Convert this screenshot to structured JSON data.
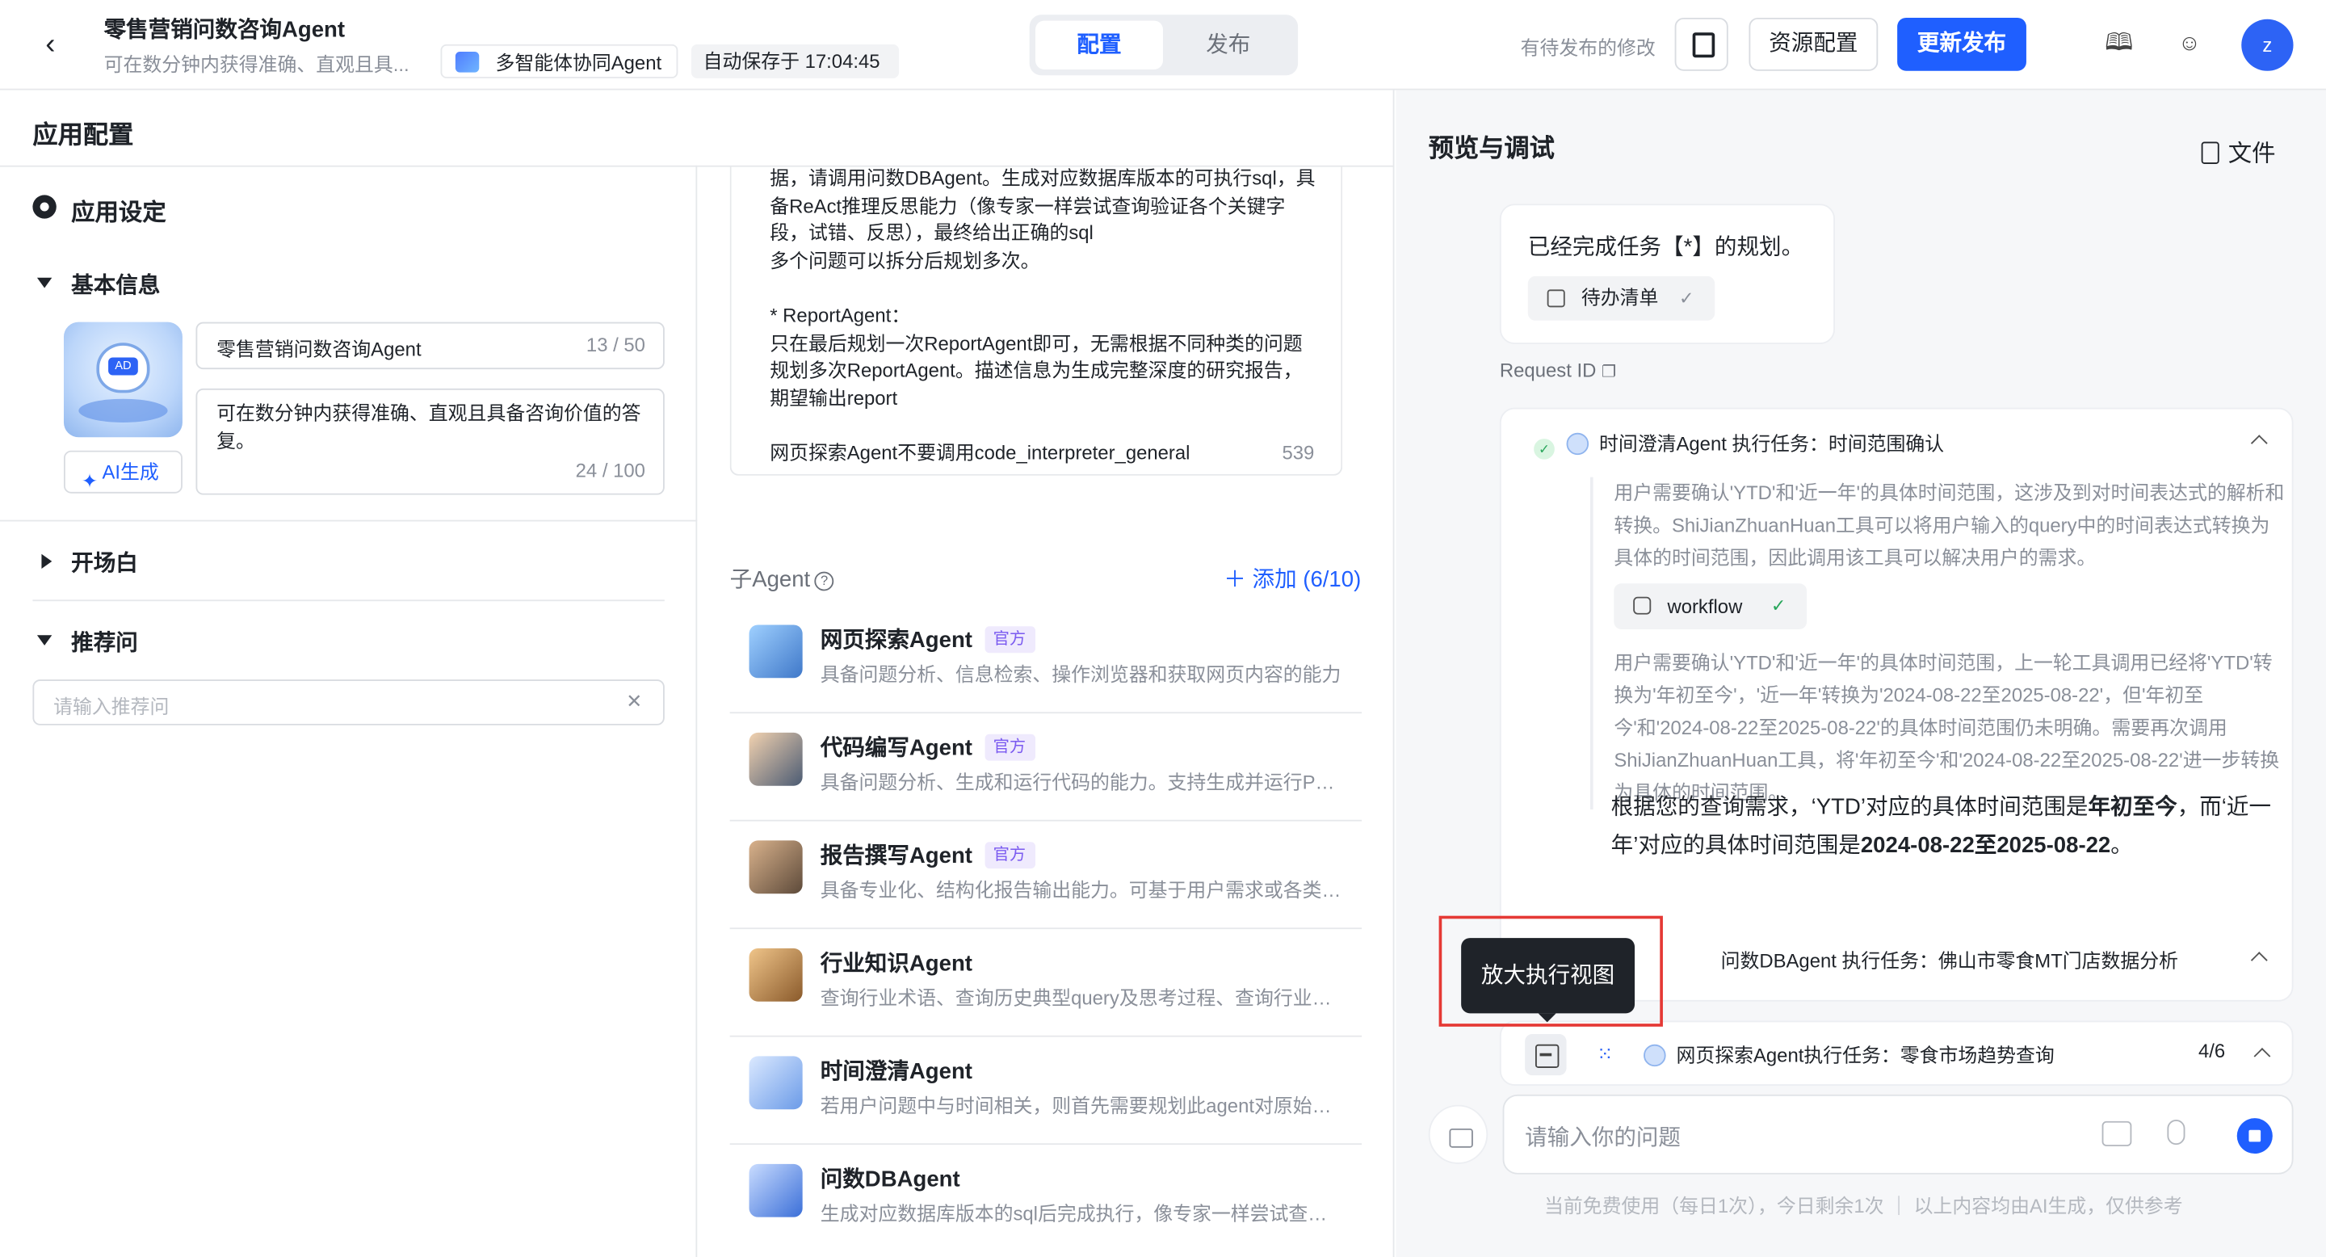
{
  "header": {
    "app_name": "零售营销问数咨询Agent",
    "app_sub": "可在数分钟内获得准确、直观且具...",
    "agent_chip": "多智能体协同Agent",
    "autosave": "自动保存于 17:04:45",
    "tabs": [
      "配置",
      "发布"
    ],
    "pending": "有待发布的修改",
    "resource_btn": "资源配置",
    "publish_btn": "更新发布",
    "avatar": "z",
    "icons": [
      "back-arrow-icon",
      "copy-icon",
      "book-icon",
      "feedback-icon"
    ]
  },
  "left": {
    "title": "应用配置",
    "app_settings": "应用设定",
    "basic_info": "基本信息",
    "name_value": "零售营销问数咨询Agent",
    "name_count": "13 / 50",
    "desc_value": "可在数分钟内获得准确、直观且具备咨询价值的答复。",
    "desc_count": "24 / 100",
    "ai_gen": "AI生成",
    "opening": "开场白",
    "recommend": "推荐问",
    "recommend_placeholder": "请输入推荐问"
  },
  "prompt": {
    "lines": [
      "据，请调用问数DBAgent。生成对应数据库版本的可执行sql，具备ReAct推理反思能力（像专家一样尝试查询验证各个关键字段，试错、反思），最终给出正确的sql",
      "多个问题可以拆分后规划多次。",
      "",
      "* ReportAgent：",
      "只在最后规划一次ReportAgent即可，无需根据不同种类的问题规划多次ReportAgent。描述信息为生成完整深度的研究报告，期望输出report",
      "",
      "网页探索Agent不要调用code_interpreter_general"
    ],
    "count": "539"
  },
  "sub_agents": {
    "title": "子Agent",
    "add": "添加 (6/10)",
    "items": [
      {
        "name": "网页探索Agent",
        "tag": "官方",
        "desc": "具备问题分析、信息检索、操作浏览器和获取网页内容的能力"
      },
      {
        "name": "代码编写Agent",
        "tag": "官方",
        "desc": "具备问题分析、生成和运行代码的能力。支持生成并运行Python代码"
      },
      {
        "name": "报告撰写Agent",
        "tag": "官方",
        "desc": "具备专业化、结构化报告输出能力。可基于用户需求或各类信息"
      },
      {
        "name": "行业知识Agent",
        "tag": "",
        "desc": "查询行业术语、查询历史典型query及思考过程、查询行业知识"
      },
      {
        "name": "时间澄清Agent",
        "tag": "",
        "desc": "若用户问题中与时间相关，则首先需要规划此agent对原始问题"
      },
      {
        "name": "问数DBAgent",
        "tag": "",
        "desc": "生成对应数据库版本的sql后完成执行，像专家一样尝试查询验证"
      }
    ]
  },
  "right": {
    "title": "预览与调试",
    "file_btn": "文件",
    "plan_msg": "已经完成任务【*】的规划。",
    "todo": "待办清单",
    "request_id": "Request ID",
    "task1_head": "时间澄清Agent 执行任务：时间范围确认",
    "task1_p1": "用户需要确认'YTD'和'近一年'的具体时间范围，这涉及到对时间表达式的解析和转换。ShiJianZhuanHuan工具可以将用户输入的query中的时间表达式转换为具体的时间范围，因此调用该工具可以解决用户的需求。",
    "workflow": "workflow",
    "task1_p2": "用户需要确认'YTD'和'近一年'的具体时间范围，上一轮工具调用已经将'YTD'转换为'年初至今'，'近一年'转换为'2024-08-22至2025-08-22'，但'年初至今'和'2024-08-22至2025-08-22'的具体时间范围仍未明确。需要再次调用ShiJianZhuanHuan工具，将'年初至今'和'2024-08-22至2025-08-22'进一步转换为具体的时间范围。",
    "answer_a": "根据您的查询需求，‘YTD’对应的具体时间范围是",
    "answer_b": "年初至今",
    "answer_c": "，而‘近一年’对应的具体时间范围是",
    "answer_d": "2024-08-22至2025-08-22",
    "answer_e": "。",
    "task2_head": "问数DBAgent 执行任务：佛山市零食MT门店数据分析",
    "tooltip": "放大执行视图",
    "bottom_task": "网页探索Agent执行任务：零食市场趋势查询",
    "bottom_count": "4/6",
    "input_placeholder": "请输入你的问题",
    "footnote": "当前免费使用（每日1次），今日剩余1次 ｜ 以上内容均由AI生成，仅供参考"
  },
  "colors": {
    "accent": "#1f5fff",
    "highlight_box": "#e53935",
    "official_tag": "#7a5af0"
  }
}
